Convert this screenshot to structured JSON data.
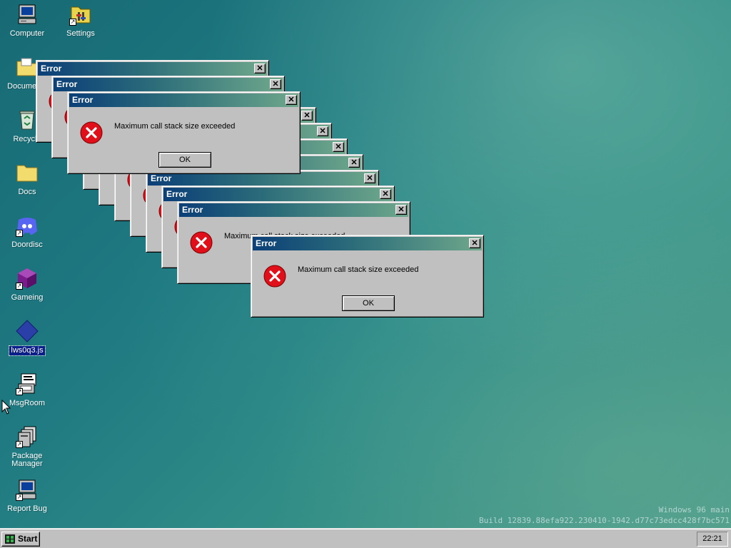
{
  "desktop": {
    "icons": [
      {
        "label": "Computer",
        "name": "computer-icon"
      },
      {
        "label": "Settings",
        "name": "settings-icon"
      },
      {
        "label": "Documents",
        "name": "documents-folder-icon"
      },
      {
        "label": "Recycle",
        "name": "recycle-bin-icon"
      },
      {
        "label": "Docs",
        "name": "docs-folder-icon"
      },
      {
        "label": "Doordisc",
        "name": "doordisc-icon"
      },
      {
        "label": "Gameing",
        "name": "gameing-icon"
      },
      {
        "label": "lws0q3.js",
        "name": "js-file-icon"
      },
      {
        "label": "MsgRoom",
        "name": "msgroom-icon"
      },
      {
        "label": "Package Manager",
        "name": "package-manager-icon"
      },
      {
        "label": "Report Bug",
        "name": "report-bug-icon"
      }
    ]
  },
  "dialog": {
    "title": "Error",
    "message": "Maximum call stack size exceeded",
    "ok_label": "OK",
    "close_glyph": "✕"
  },
  "watermark": {
    "line1": "Windows 96 main",
    "line2": "Build 12839.88efa922.230410-1942.d77c73edcc428f7bc571"
  },
  "taskbar": {
    "start_label": "Start",
    "clock": "22:21"
  },
  "colors": {
    "desktop_teal": "#1f7a82",
    "titlebar_start": "#0b3f78",
    "titlebar_end": "#6fa88c",
    "error_red": "#e0101a",
    "window_gray": "#c0c0c0"
  }
}
